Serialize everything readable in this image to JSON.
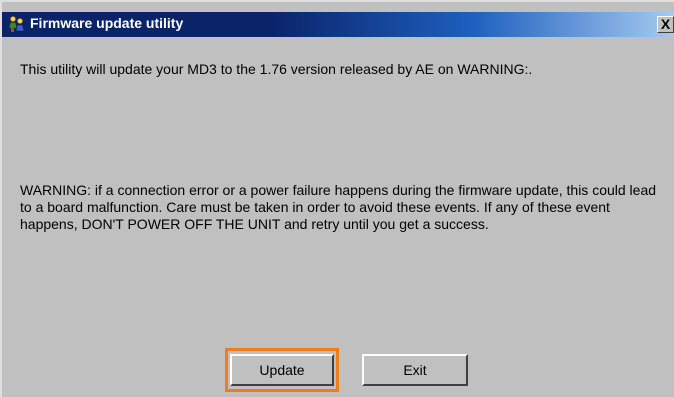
{
  "window": {
    "title": "Firmware update utility",
    "close_label": "X"
  },
  "content": {
    "line1": "This utility will update your MD3 to the 1.76 version released by AE on WARNING:.",
    "warning": "WARNING: if a connection error or a power failure happens during the firmware update, this could lead to a board malfunction. Care must be taken in order to avoid these events. If any of these event happens, DON'T POWER OFF THE UNIT and retry until you get a success."
  },
  "buttons": {
    "update_label": "Update",
    "exit_label": "Exit"
  },
  "colors": {
    "titlebar": "#0a246a",
    "highlight": "#f07d1a",
    "face": "#c0c0c0"
  },
  "icons": {
    "title": "app-people-icon",
    "close": "close-icon"
  }
}
